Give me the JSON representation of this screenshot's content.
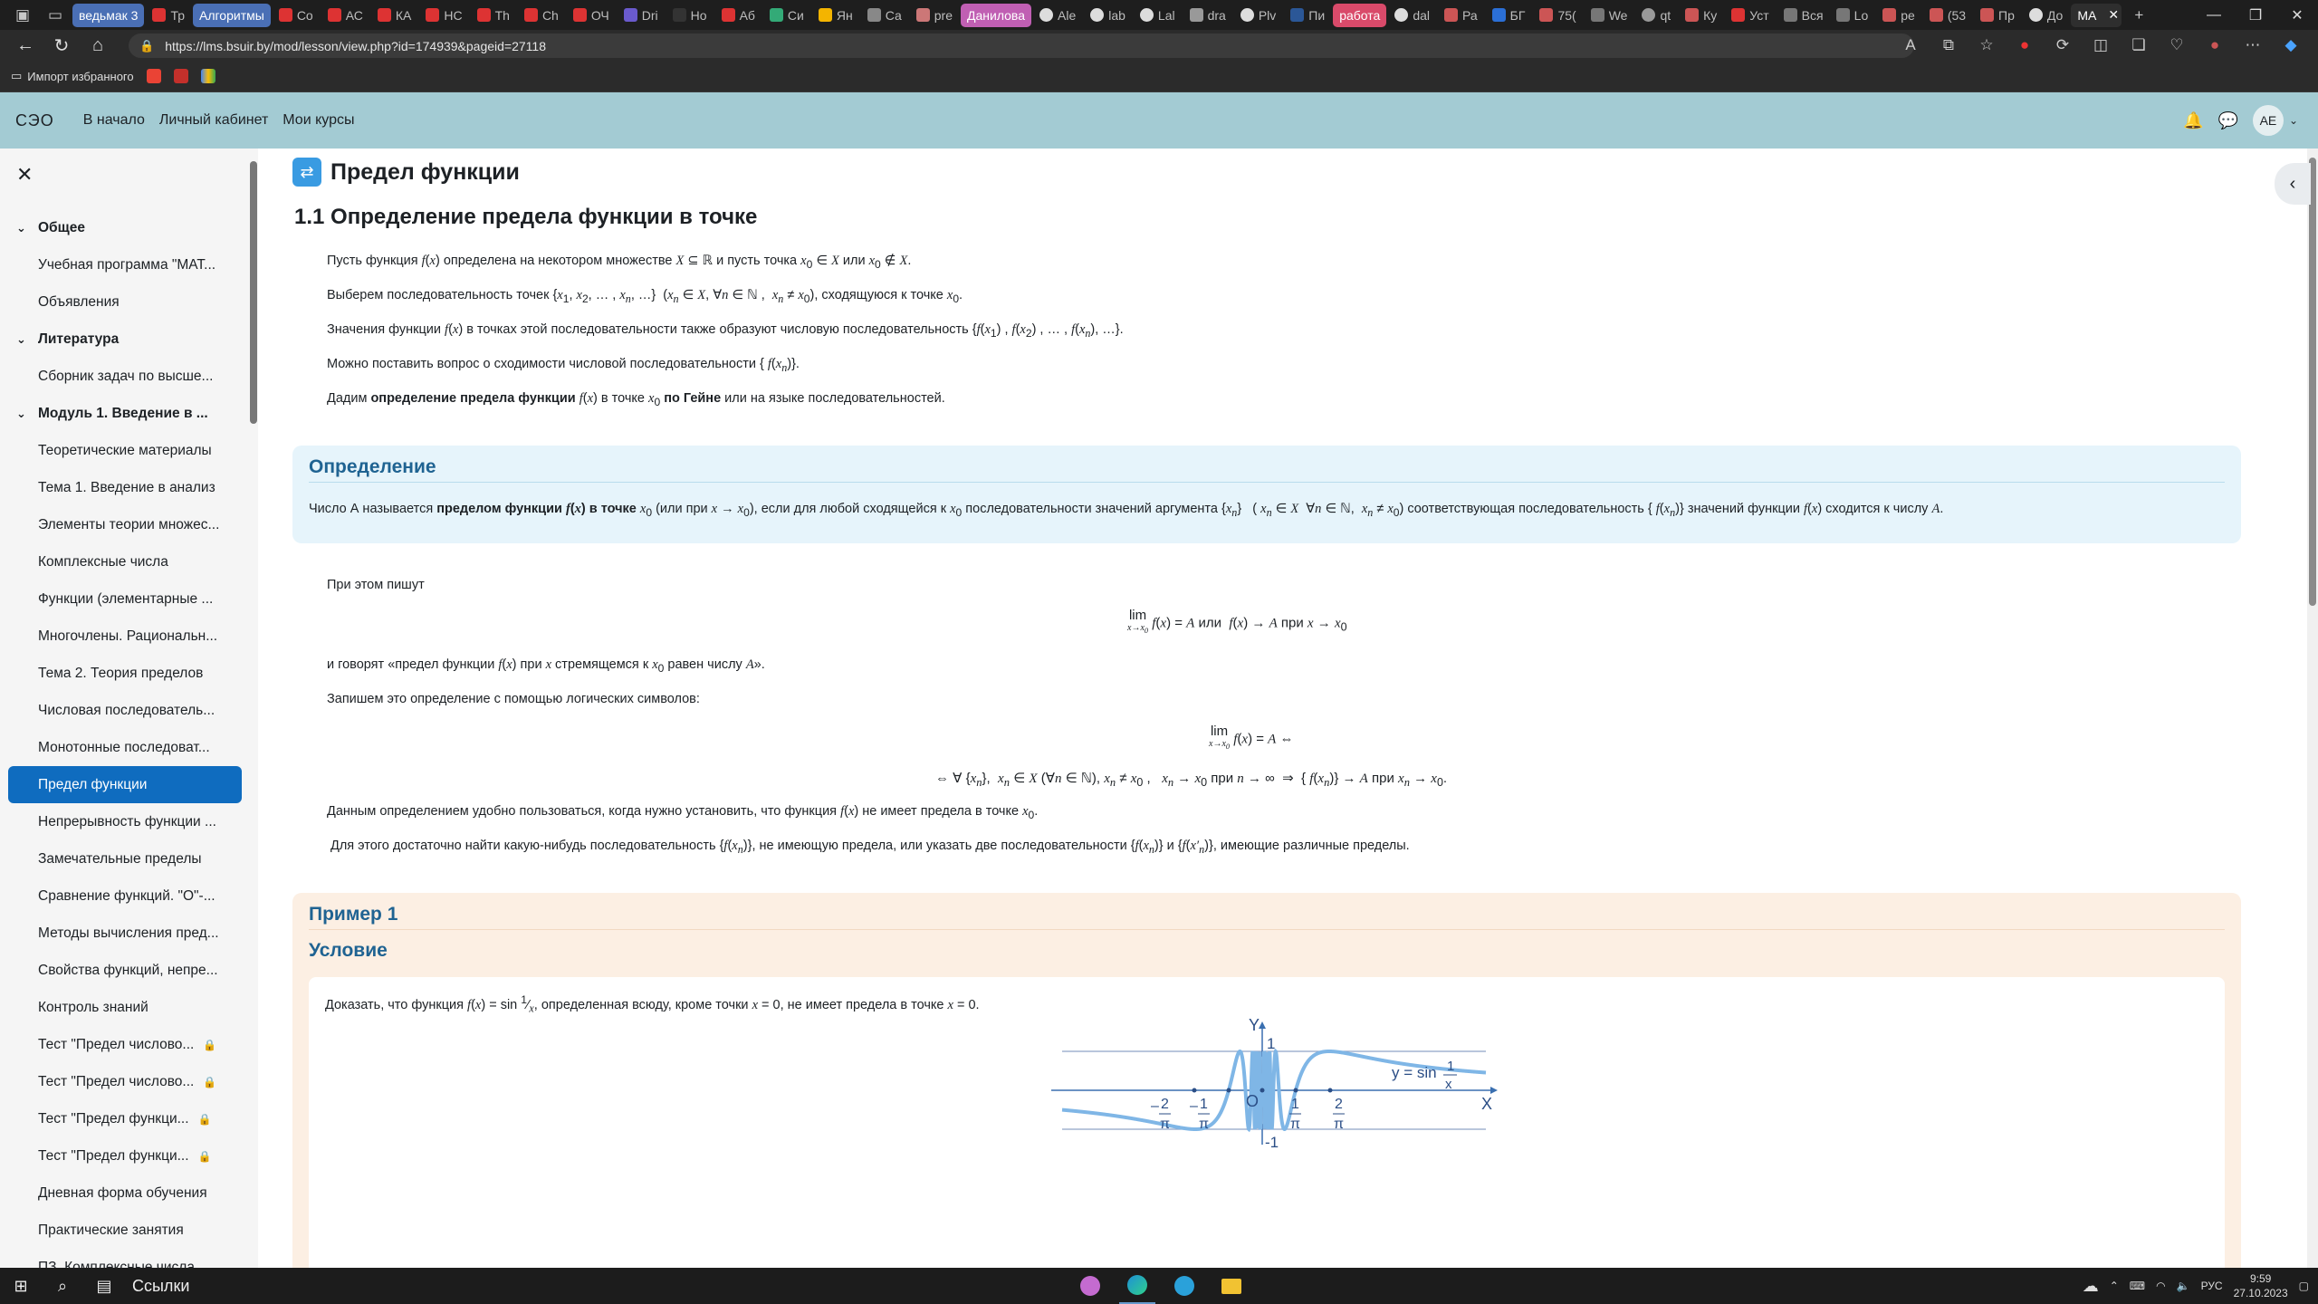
{
  "browser": {
    "tabs": [
      "ведьмак 3",
      "Тр",
      "Алгоритмы",
      "Co",
      "АС",
      "КА",
      "НС",
      "Th",
      "Ch",
      "ОЧ",
      "Dri",
      "Но",
      "Аб",
      "Си",
      "Ян",
      "Са",
      "pre",
      "Данилова",
      "Ale",
      "lab",
      "Lal",
      "dra",
      "Plv",
      "Пи",
      "работа",
      "dal",
      "Ра",
      "БГ",
      "75(",
      "We",
      "qt",
      "Ку",
      "Уст",
      "Вся",
      "Lo",
      "ре",
      "(53",
      "Пр",
      "До",
      "МА"
    ],
    "url": "https://lms.bsuir.by/mod/lesson/view.php?id=174939&pageid=27118",
    "bookmarks": {
      "import": "Импорт избранного"
    }
  },
  "navbar": {
    "brand": "СЭО",
    "links": [
      "В начало",
      "Личный кабинет",
      "Мои курсы"
    ],
    "avatar": "АЕ"
  },
  "sidebar": {
    "items": [
      {
        "label": "Общее",
        "kind": "sec"
      },
      {
        "label": "Учебная программа \"МАТ...",
        "kind": "sub"
      },
      {
        "label": "Объявления",
        "kind": "sub"
      },
      {
        "label": "Литература",
        "kind": "sec"
      },
      {
        "label": "Сборник задач по высше...",
        "kind": "sub"
      },
      {
        "label": "Модуль 1. Введение в ...",
        "kind": "sec"
      },
      {
        "label": "Теоретические материалы",
        "kind": "sub"
      },
      {
        "label": "Тема 1. Введение в анализ",
        "kind": "sub"
      },
      {
        "label": "Элементы теории множес...",
        "kind": "sub"
      },
      {
        "label": "Комплексные числа",
        "kind": "sub"
      },
      {
        "label": "Функции (элементарные ...",
        "kind": "sub"
      },
      {
        "label": "Многочлены. Рациональн...",
        "kind": "sub"
      },
      {
        "label": "Тема 2. Теория пределов",
        "kind": "sub"
      },
      {
        "label": "Числовая последователь...",
        "kind": "sub"
      },
      {
        "label": "Монотонные последоват...",
        "kind": "sub"
      },
      {
        "label": "Предел функции",
        "kind": "active"
      },
      {
        "label": "Непрерывность функции ...",
        "kind": "sub"
      },
      {
        "label": "Замечательные пределы",
        "kind": "sub"
      },
      {
        "label": "Сравнение функций. \"О\"-...",
        "kind": "sub"
      },
      {
        "label": "Методы вычисления пред...",
        "kind": "sub"
      },
      {
        "label": "Свойства функций, непре...",
        "kind": "sub"
      },
      {
        "label": "Контроль знаний",
        "kind": "sub"
      },
      {
        "label": "Тест \"Предел числово...",
        "kind": "lock"
      },
      {
        "label": "Тест \"Предел числово...",
        "kind": "lock"
      },
      {
        "label": "Тест \"Предел функци...",
        "kind": "lock"
      },
      {
        "label": "Тест \"Предел функци...",
        "kind": "lock"
      },
      {
        "label": "Дневная форма обучения",
        "kind": "sub"
      },
      {
        "label": "Практические занятия",
        "kind": "sub"
      },
      {
        "label": "ПЗ. Комплексные числа",
        "kind": "sub"
      }
    ]
  },
  "page": {
    "title": "Предел функции",
    "section": "1.1 Определение предела функции в точке",
    "p1_a": "Пусть функция",
    "p1_b": "определена на некотором множестве",
    "p1_c": "и пусть точка",
    "p1_d": "или",
    "p2_a": "Выберем последовательность точек",
    "p2_b": ", сходящуюся к точке",
    "p3_a": "Значения функции",
    "p3_b": "в точках этой последовательности также образуют числовую последовательность",
    "p4_a": "Можно поставить вопрос о сходимости числовой последовательности",
    "p5_a": "Дадим",
    "p5_b": "определение предела функции",
    "p5_c": "в точке",
    "p5_d": "по Гейне",
    "p5_e": "или на языке последовательностей.",
    "def_title": "Определение",
    "def_a": "Число А называется",
    "def_b": "пределом функции",
    "def_c": "в точке",
    "def_d": "(или при",
    "def_e": "), если для любой сходящейся к",
    "def_f": "последовательности значений аргумента",
    "def_g": "соответствующая последовательность",
    "def_h": "значений функции",
    "def_i": "сходится к числу",
    "write": "При этом пишут",
    "ili": "или",
    "pri": "при",
    "say_a": "и говорят «предел функции",
    "say_b": "при",
    "say_c": "стремящемся к",
    "say_d": "равен числу",
    "logic": "Запишем это определение с помощью логических символов:",
    "use_a": "Данным определением удобно пользоваться, когда нужно установить, что функция",
    "use_b": "не имеет предела в точке",
    "enough_a": "Для этого достаточно найти какую-нибудь последовательность",
    "enough_b": ", не имеющую предела, или указать две последовательности",
    "enough_c": "и",
    "enough_d": ", имеющие различные пределы.",
    "ex_title": "Пример 1",
    "cond_title": "Условие",
    "cond_a": "Доказать, что функция",
    "cond_b": ", определенная всюду, кроме точки",
    "cond_c": ", не имеет предела в точке"
  },
  "graph": {
    "y_label": "Y",
    "x_label": "X",
    "origin": "O",
    "one": "1",
    "minus_one": "-1",
    "func_label": "y = sin",
    "ticks": [
      "-2/π",
      "-1/π",
      "1/π",
      "2/π"
    ]
  },
  "taskbar": {
    "links": "Ссылки",
    "lang": "РУС",
    "time": "9:59",
    "date": "27.10.2023"
  }
}
